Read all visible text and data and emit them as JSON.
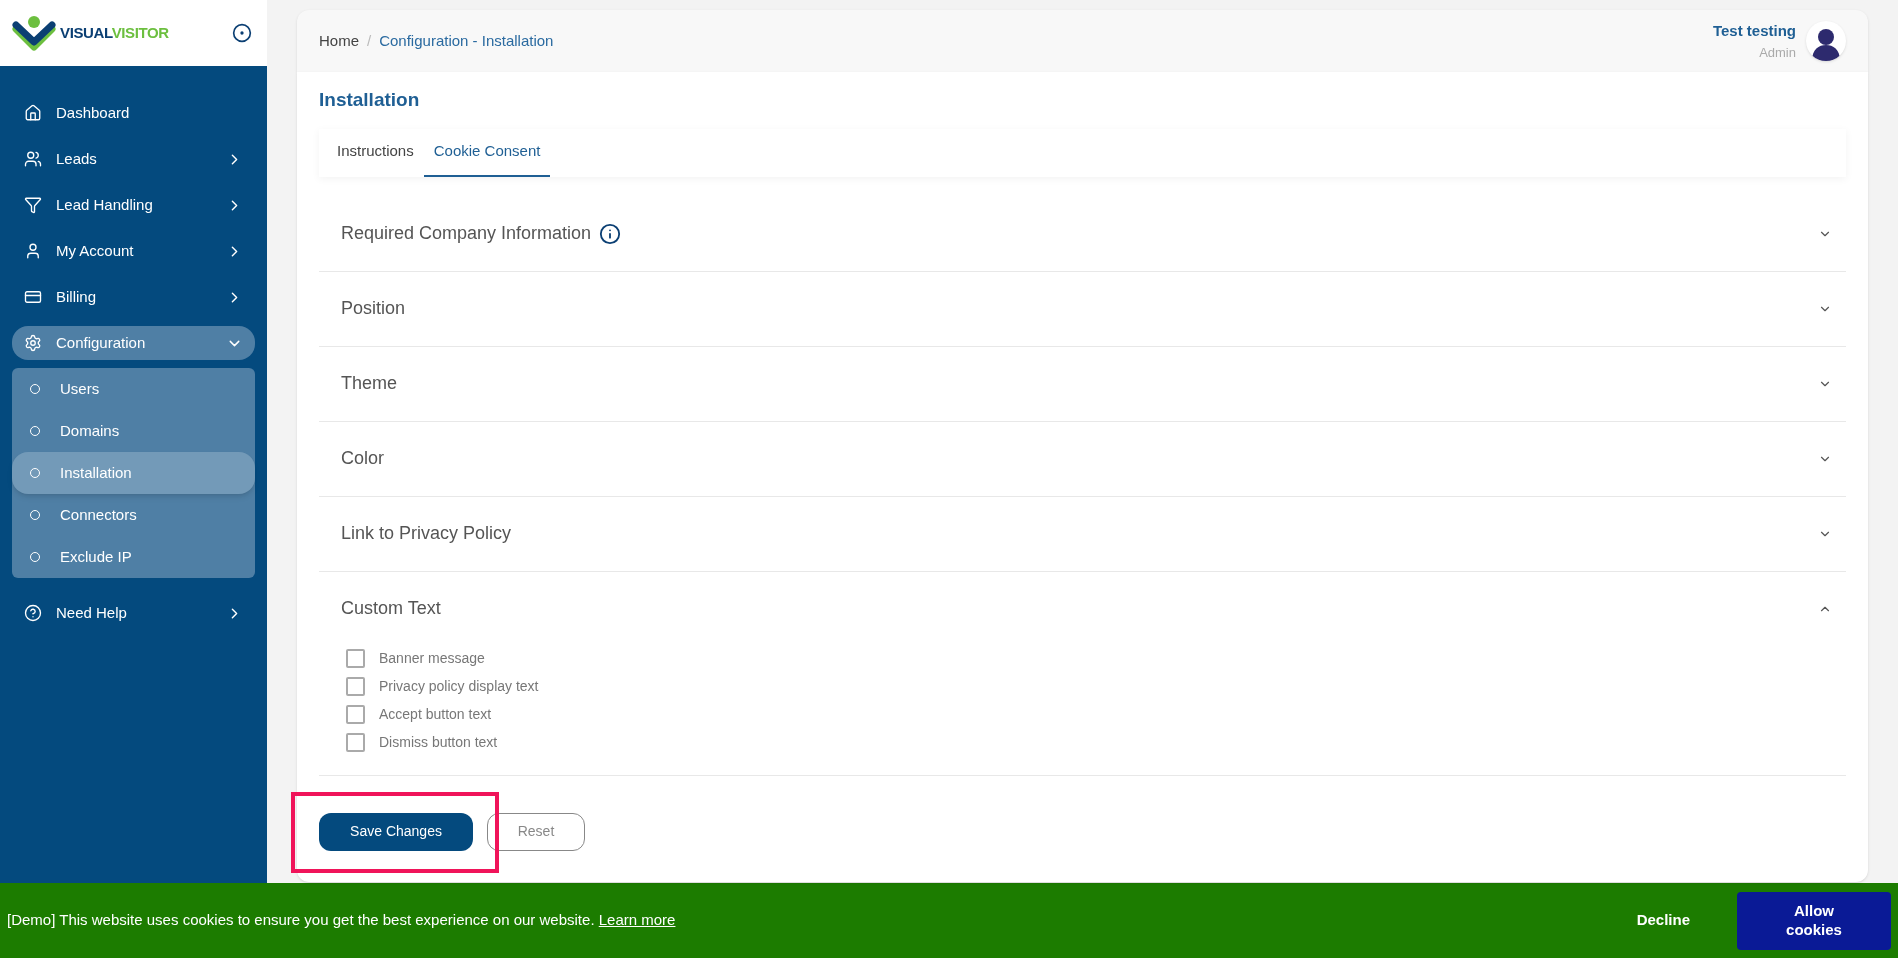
{
  "logo": {
    "parts": [
      "VISUAL",
      "VISITOR"
    ]
  },
  "sidebar": {
    "items": [
      {
        "label": "Dashboard",
        "kind": "plain",
        "selected": false
      },
      {
        "label": "Leads",
        "kind": "expandable",
        "expanded": false,
        "selected": false
      },
      {
        "label": "Lead Handling",
        "kind": "expandable",
        "expanded": false,
        "selected": false
      },
      {
        "label": "My Account",
        "kind": "expandable",
        "expanded": false,
        "selected": false
      },
      {
        "label": "Billing",
        "kind": "expandable",
        "expanded": false,
        "selected": false
      },
      {
        "label": "Configuration",
        "kind": "expandable",
        "expanded": true,
        "selected": true,
        "children": [
          {
            "label": "Users",
            "selected": false
          },
          {
            "label": "Domains",
            "selected": false
          },
          {
            "label": "Installation",
            "selected": true
          },
          {
            "label": "Connectors",
            "selected": false
          },
          {
            "label": "Exclude IP",
            "selected": false
          }
        ]
      },
      {
        "label": "Need Help",
        "kind": "expandable",
        "expanded": false,
        "selected": false
      }
    ]
  },
  "breadcrumb": {
    "items": [
      "Home",
      "Configuration - Installation"
    ],
    "separator": "/"
  },
  "user": {
    "name": "Test testing",
    "role": "Admin"
  },
  "page_title": "Installation",
  "tabs": [
    {
      "label": "Instructions",
      "selected": false
    },
    {
      "label": "Cookie Consent",
      "selected": true
    }
  ],
  "sections": [
    {
      "title": "Required Company Information",
      "info": true,
      "expanded": false
    },
    {
      "title": "Position",
      "info": false,
      "expanded": false
    },
    {
      "title": "Theme",
      "info": false,
      "expanded": false
    },
    {
      "title": "Color",
      "info": false,
      "expanded": false
    },
    {
      "title": "Link to Privacy Policy",
      "info": false,
      "expanded": false
    },
    {
      "title": "Custom Text",
      "info": false,
      "expanded": true,
      "options": [
        {
          "label": "Banner message",
          "checked": false
        },
        {
          "label": "Privacy policy display text",
          "checked": false
        },
        {
          "label": "Accept button text",
          "checked": false
        },
        {
          "label": "Dismiss button text",
          "checked": false
        }
      ]
    }
  ],
  "buttons": {
    "save": "Save Changes",
    "reset": "Reset"
  },
  "cookie_banner": {
    "message": "[Demo] This website uses cookies to ensure you get the best experience on our website.",
    "link": "Learn more",
    "decline": "Decline",
    "allow": "Allow cookies"
  }
}
